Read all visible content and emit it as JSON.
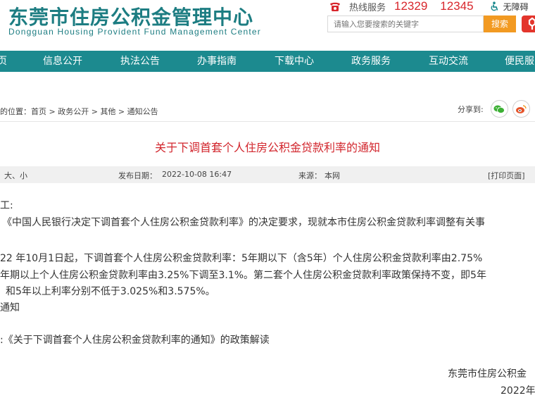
{
  "header": {
    "logo_cn": "东莞市住房公积金管理中心",
    "logo_en": "Dongguan Housing Provident Fund Management Center",
    "hotline_label": "热线服务",
    "hotline_numbers": [
      "12329",
      "12345"
    ],
    "accessibility_label": "无障碍",
    "search_placeholder": "请输入您要搜索的关键字",
    "search_button": "搜索"
  },
  "nav": {
    "items": [
      "页",
      "信息公开",
      "执法公告",
      "办事指南",
      "下载中心",
      "政务服务",
      "互动交流",
      "便民服"
    ]
  },
  "breadcrumb": {
    "prefix": "的位置：",
    "items": [
      "首页",
      "政务公开",
      "其他",
      "通知公告"
    ],
    "separator": " > "
  },
  "share": {
    "label": "分享到:"
  },
  "article": {
    "title": "关于下调首套个人住房公积金贷款利率的通知",
    "meta": {
      "font_size": "大、小",
      "publish_date_label": "发布日期：",
      "publish_date": "2022-10-08 16:47",
      "source_label": "来源：",
      "source": "本网",
      "print": "[打印页面]"
    },
    "lines": [
      "工:",
      "《中国人民银行决定下调首套个人住房公积金贷款利率》的决定要求，现就本市住房公积金贷款利率调整有关事",
      "22 年10月1日起，下调首套个人住房公积金贷款利率：5年期以下（含5年）个人住房公积金贷款利率由2.75%",
      "年期以上个人住房公积金贷款利率由3.25%下调至3.1%。第二套个人住房公积金贷款利率政策保持不变，即5年",
      "和5年以上利率分别不低于3.025%和3.575%。",
      "通知",
      ":《关于下调首套个人住房公积金贷款利率的通知》的政策解读"
    ],
    "sign_org": "东莞市住房公积金",
    "sign_date": "2022年"
  },
  "colors": {
    "brand_teal": "#1c8a8f",
    "title_red": "#d2262d",
    "search_orange": "#f29a22"
  }
}
